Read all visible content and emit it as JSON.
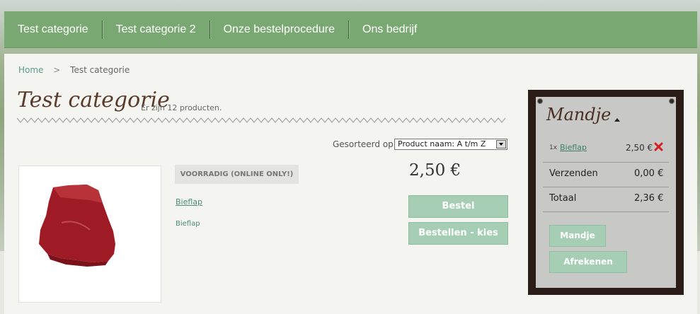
{
  "nav": {
    "items": [
      "Test categorie",
      "Test categorie 2",
      "Onze bestelprocedure",
      "Ons bedrijf"
    ]
  },
  "breadcrumb": {
    "home": "Home",
    "separator": ">",
    "current": "Test categorie"
  },
  "category": {
    "title": "Test categorie",
    "count_text": "Er zijn 12 producten."
  },
  "sort": {
    "label": "Gesorteerd op",
    "selected": "Product naam: A t/m Z"
  },
  "product": {
    "stock_badge": "VOORRADIG (ONLINE ONLY!)",
    "name": "Bieflap",
    "description": "Bieflap",
    "price": "2,50 €",
    "buttons": {
      "order": "Bestel",
      "order_choose": "Bestellen - kies"
    },
    "image_icon": "meat-image"
  },
  "cart": {
    "title": "Mandje",
    "item": {
      "qty": "1x",
      "name": "Bieflap",
      "price": "2,50 €"
    },
    "shipping": {
      "label": "Verzenden",
      "value": "0,00 €"
    },
    "total": {
      "label": "Totaal",
      "value": "2,36 €"
    },
    "buttons": {
      "cart": "Mandje",
      "checkout": "Afrekenen"
    }
  },
  "colors": {
    "nav": "#7aa872",
    "button": "#a5ceb4",
    "cart_frame": "#2b1c18",
    "link": "#4b8f6e"
  }
}
